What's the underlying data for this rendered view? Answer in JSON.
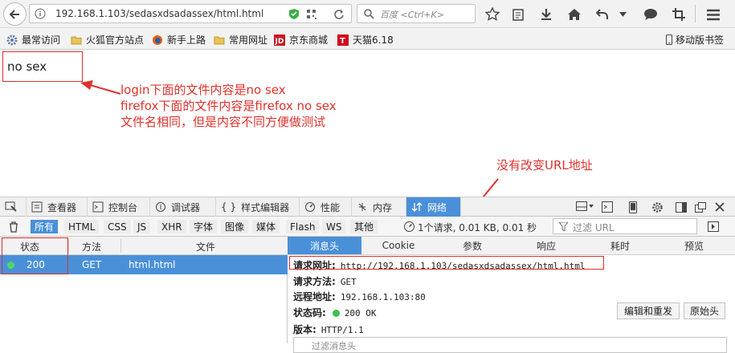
{
  "browser": {
    "url": "192.168.1.103/sedasxdsadassex/html.html",
    "search_placeholder": "百度 <Ctrl+K>"
  },
  "bookmarks": [
    {
      "label": "最常访问",
      "icon": "gear-icon"
    },
    {
      "label": "火狐官方站点",
      "icon": "folder-icon"
    },
    {
      "label": "新手上路",
      "icon": "firefox-icon"
    },
    {
      "label": "常用网址",
      "icon": "folder-icon"
    },
    {
      "label": "京东商城",
      "icon": "jd-icon"
    },
    {
      "label": "天猫6.18",
      "icon": "tmall-icon"
    }
  ],
  "mobile_bookmarks": "移动版书签",
  "page": {
    "text": "no sex",
    "note_lines": [
      "login下面的文件内容是no sex",
      "firefox下面的文件内容是firefox no sex",
      "文件名相同，但是内容不同方便做测试"
    ],
    "note_url": "没有改变URL地址"
  },
  "devtools": {
    "tabs": [
      "查看器",
      "控制台",
      "调试器",
      "样式编辑器",
      "性能",
      "内存",
      "网络"
    ],
    "filters": [
      "所有",
      "HTML",
      "CSS",
      "JS",
      "XHR",
      "字体",
      "图像",
      "媒体",
      "Flash",
      "WS",
      "其他"
    ],
    "summary": "1个请求, 0.01 KB, 0.01 秒",
    "url_filter_placeholder": "过滤 URL",
    "list_columns": [
      "状态",
      "方法",
      "文件"
    ],
    "request": {
      "status": "200",
      "method": "GET",
      "file": "html.html"
    },
    "detail_tabs": [
      "消息头",
      "Cookie",
      "参数",
      "响应",
      "耗时",
      "预览"
    ],
    "details": {
      "req_url_label": "请求网址:",
      "req_url": "http://192.168.1.103/sedasxdsadassex/html.html",
      "method_label": "请求方法:",
      "method": "GET",
      "remote_label": "远程地址:",
      "remote": "192.168.1.103:80",
      "status_label": "状态码:",
      "status": "200 OK",
      "version_label": "版本:",
      "version": "HTTP/1.1",
      "filter_headers": "过滤消息头"
    },
    "edit_resend": "编辑和重发",
    "raw_headers": "原始头"
  }
}
